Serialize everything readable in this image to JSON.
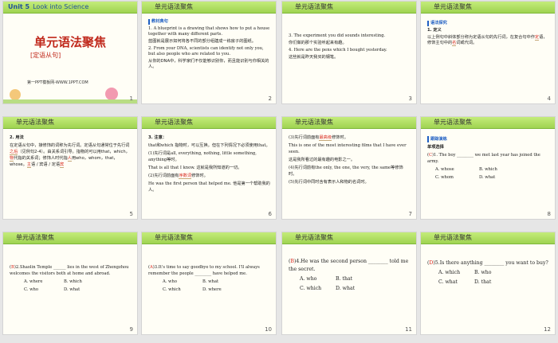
{
  "slide1": {
    "unit_label": "Unit 5",
    "unit_title": "Look into Science",
    "main_title": "单元语法聚焦",
    "subtitle": "[定语从句]",
    "credit": "第一PPT模板网-WWW.1PPT.COM",
    "number": "1"
  },
  "header_title": "单元语法聚焦",
  "slide2": {
    "section": "教材典句",
    "s1": "1. A blueprint is a drawing that shows how to put a house together with many different parts.",
    "s1_cn": "蓝图就是展示如何将各不同的部分组建成一栋房子的图纸。",
    "s2": "2. From your DNA, scientists can identify not only you, but also people who are related to you.",
    "s2_cn": "从你的DNA中，科学家们不仅能够识别你，而且能识别与你相关的人。",
    "number": "2"
  },
  "slide3": {
    "s3": "3. The experiment you did sounds interesting.",
    "s3_cn": "你们做的那个实验听起来有趣。",
    "s4": "4. Here are the pens which I bought yesterday.",
    "s4_cn": "这些就是昨天我买的钢笔。",
    "number": "3"
  },
  "slide4": {
    "section": "语法探究",
    "h": "1. 定义",
    "p1": "以上例句中斜体部分称为定语从句的先行词，",
    "p2": "在复合句中作",
    "b1": "定",
    "p3": "语，修饰主句中的",
    "b2": "名",
    "p4": "词或代词。",
    "number": "4"
  },
  "slide5": {
    "h": "2. 用法",
    "l1": "在定语从句中，接修饰的词称为先行词。定语从句通常位于先行词",
    "b1": "之后",
    "l2": "（见例句2-4）。由关系词引导。指物的可以用that，which，",
    "b2": "物",
    "l3": "代指的关系词；修饰人时代指",
    "b3": "人",
    "l4": "用who，whom，that，whose。",
    "b4": "主",
    "l5": "语 / 宾语 / 定语",
    "b5": "宾",
    "number": "5"
  },
  "slide6": {
    "h": "3. 注意：",
    "l1": "that和which 指物时，可以互换。但在下列情况下必须使用that。",
    "l2": "(1)先行词是all, everything, nothing, little something, anything等时。",
    "l3": "That is all that I know. 这就是我所知道的一切。",
    "l4a": "(2)先行词前面有",
    "b1": "序数词",
    "l4b": "修饰时。",
    "l5": "He was the first person that helped me. 他是第一个帮助我的人。",
    "number": "6"
  },
  "slide7": {
    "l1a": "(3)先行词前面有",
    "b1": "最高级",
    "l1b": "修饰时。",
    "l2": "This is one of the most interesting films that I have ever seen.",
    "l2_cn": "这是我所看过的最有趣的电影之一。",
    "l3": "(4)先行词前有the only, the one, the very, the same等修饰时。",
    "l4": "(5)先行词中同时含有表示人和物的名词时。",
    "number": "7"
  },
  "slide8": {
    "section": "跟踪演练",
    "h": "单项选择",
    "ans": "C",
    "q": ")1. The boy ________ we met last year has joined the army.",
    "oA": "A. whose",
    "oB": "B. which",
    "oC": "C. whom",
    "oD": "D. what",
    "number": "8"
  },
  "slide9": {
    "ans": "B",
    "q": ")2.Shaolin Temple ______ lies in the west of Zhengzhou welcomes the visitors both at home and abroad.",
    "oA": "A. where",
    "oB": "B. which",
    "oC": "C. who",
    "oD": "D. what",
    "number": "9"
  },
  "slide10": {
    "ans": "A",
    "q": ")3.It's time to say goodbye to my school. I'll always remember the people ________ have helped me.",
    "oA": "A. who",
    "oB": "B. what",
    "oC": "C. which",
    "oD": "D. where",
    "number": "10"
  },
  "slide11": {
    "ans": "B",
    "q": ")4.He was the second person ________ told me the secret.",
    "oA": "A. who",
    "oB": "B. that",
    "oC": "C. which",
    "oD": "D. what",
    "number": "11"
  },
  "slide12": {
    "ans": "D",
    "q": ")5.Is there anything ________ you want to buy?",
    "oA": "A. which",
    "oB": "B. who",
    "oC": "C. what",
    "oD": "D. that",
    "number": "12"
  }
}
